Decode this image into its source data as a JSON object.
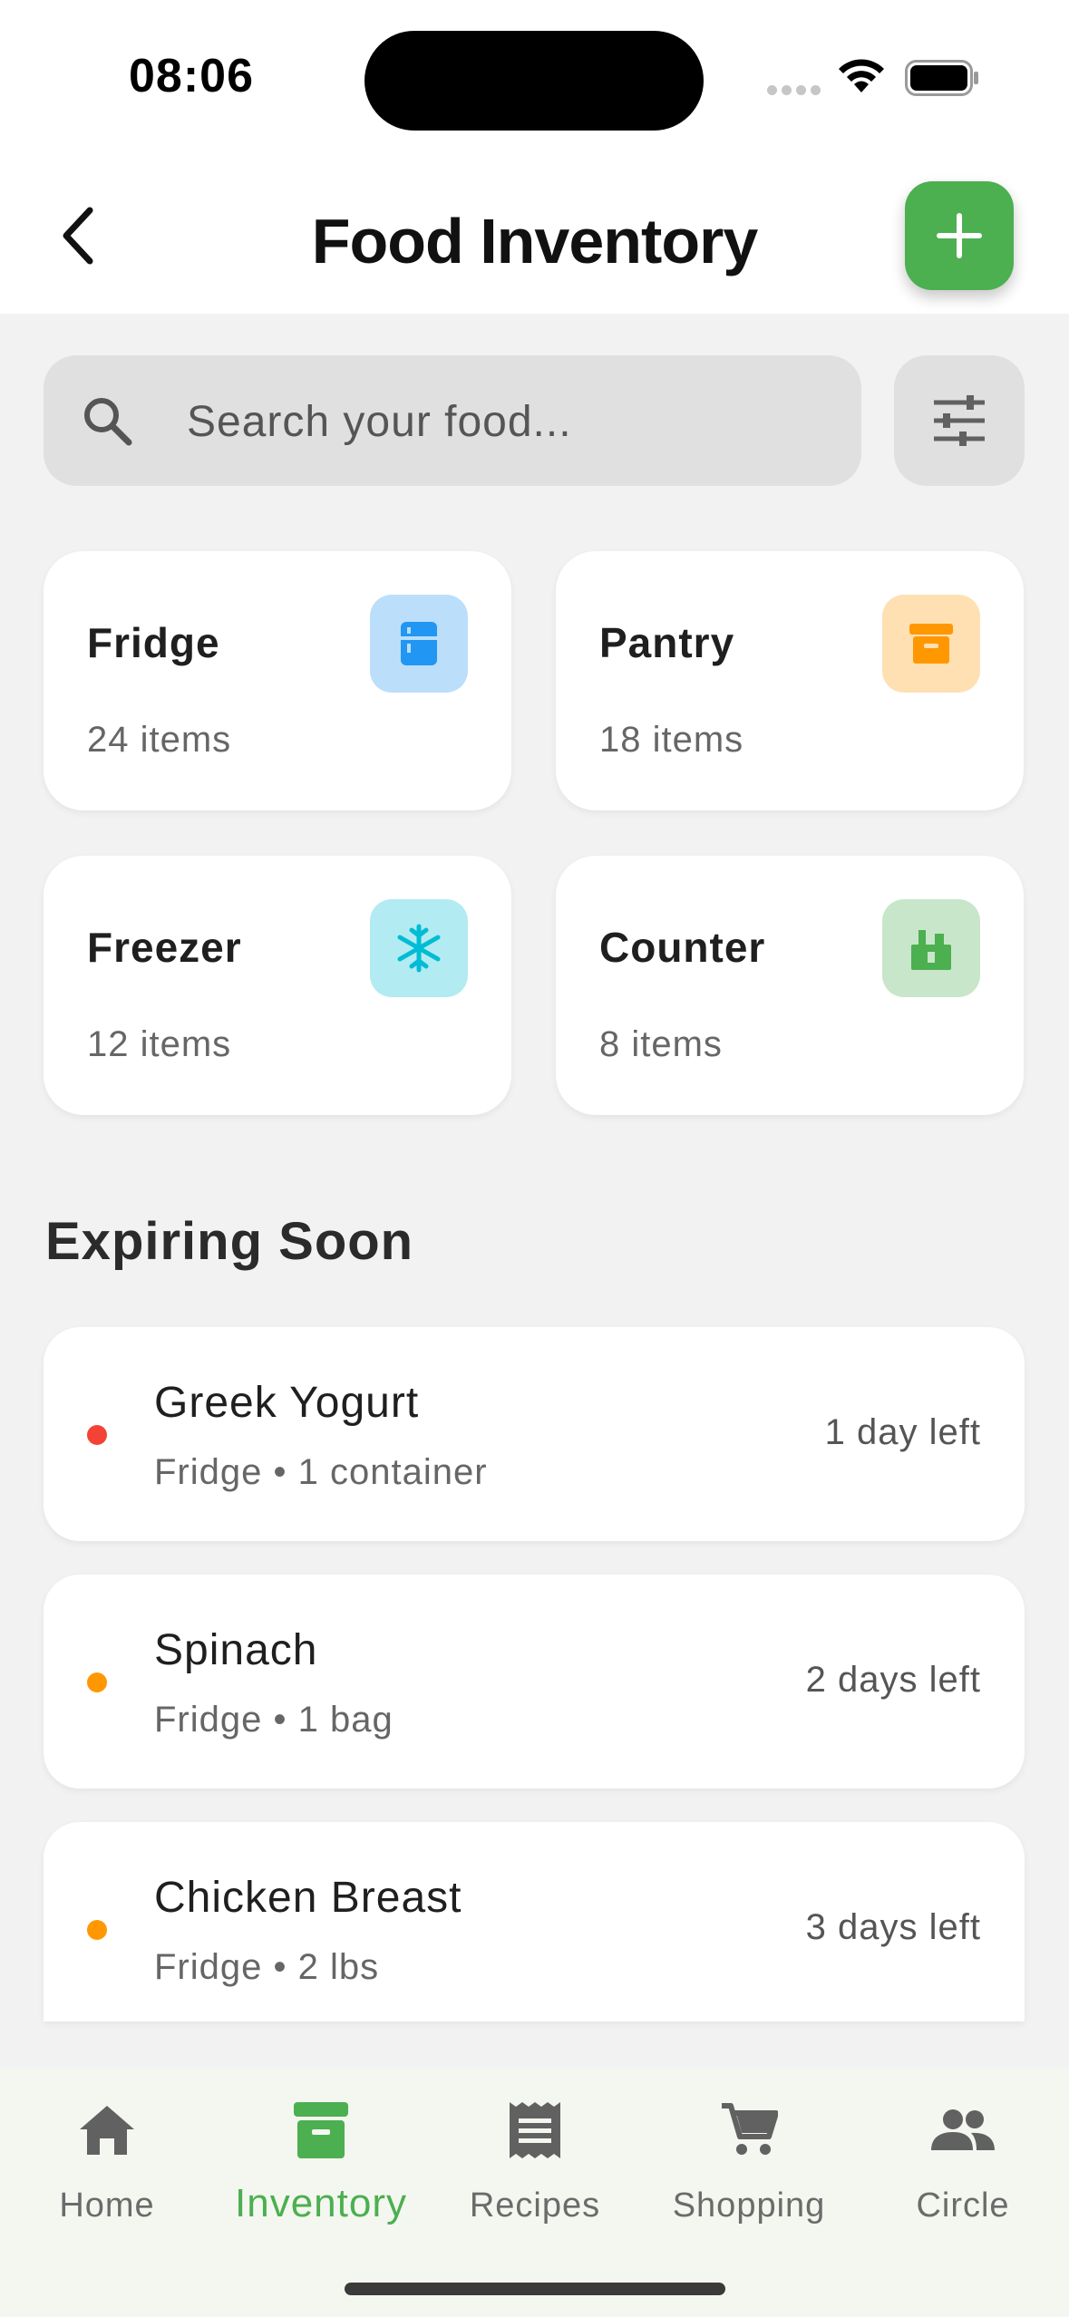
{
  "status_bar": {
    "time": "08:06"
  },
  "header": {
    "title": "Food Inventory",
    "back_icon": "chevron-left-icon",
    "add_icon": "plus-icon"
  },
  "search": {
    "placeholder": "Search your food...",
    "value": "",
    "icon": "search-icon",
    "filter_icon": "sliders-icon"
  },
  "storage": [
    {
      "name": "Fridge",
      "count": "24 items",
      "icon": "fridge-icon",
      "icon_bg": "#bbdefb",
      "icon_color": "#2196f3"
    },
    {
      "name": "Pantry",
      "count": "18 items",
      "icon": "archive-box-icon",
      "icon_bg": "#ffe0b2",
      "icon_color": "#ff9800"
    },
    {
      "name": "Freezer",
      "count": "12 items",
      "icon": "snowflake-icon",
      "icon_bg": "#b2ebf2",
      "icon_color": "#00bcd4"
    },
    {
      "name": "Counter",
      "count": "8 items",
      "icon": "countertop-icon",
      "icon_bg": "#c8e6c9",
      "icon_color": "#4caf50"
    }
  ],
  "expiring": {
    "title": "Expiring Soon",
    "items": [
      {
        "name": "Greek Yogurt",
        "detail": "Fridge • 1 container",
        "days": "1 day left",
        "dot_color": "#f44336"
      },
      {
        "name": "Spinach",
        "detail": "Fridge • 1 bag",
        "days": "2 days left",
        "dot_color": "#ff9800"
      },
      {
        "name": "Chicken Breast",
        "detail": "Fridge • 2 lbs",
        "days": "3 days left",
        "dot_color": "#ff9800"
      }
    ]
  },
  "nav": {
    "items": [
      {
        "label": "Home",
        "icon": "home-icon",
        "active": false
      },
      {
        "label": "Inventory",
        "icon": "inventory-icon",
        "active": true
      },
      {
        "label": "Recipes",
        "icon": "receipt-icon",
        "active": false
      },
      {
        "label": "Shopping",
        "icon": "cart-icon",
        "active": false
      },
      {
        "label": "Circle",
        "icon": "people-icon",
        "active": false
      }
    ]
  },
  "colors": {
    "accent": "#4caf50",
    "nav_inactive": "#6b6b6b"
  }
}
